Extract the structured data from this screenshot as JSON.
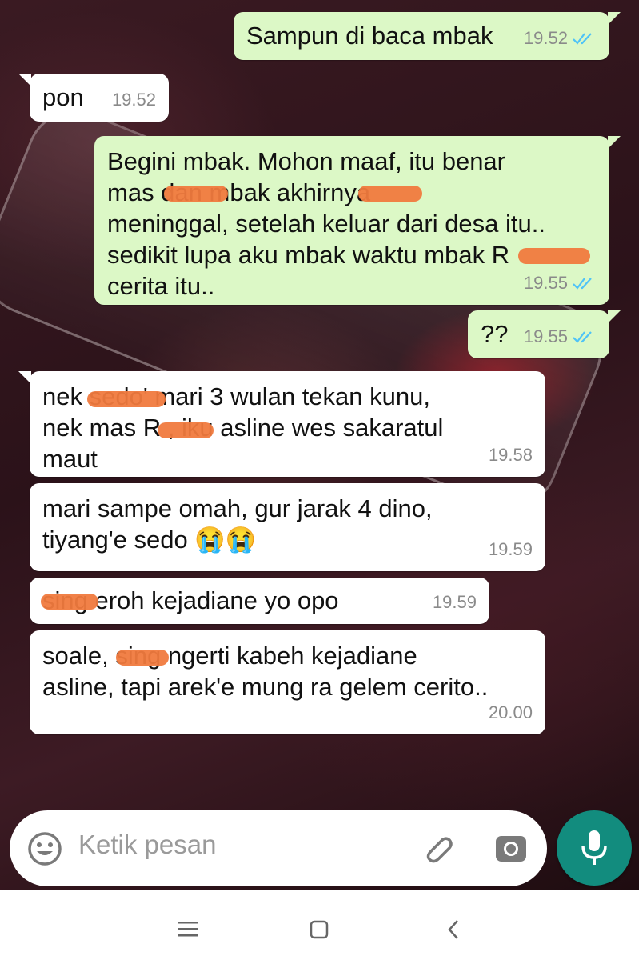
{
  "chat": {
    "messages": [
      {
        "direction": "outgoing",
        "text": "Sampun di baca mbak",
        "time": "19.52",
        "status": "read"
      },
      {
        "direction": "incoming",
        "text": "pon",
        "time": "19.52"
      },
      {
        "direction": "outgoing",
        "text": "Begini mbak. Mohon maaf, itu benar\nmas          dan mbak          akhirnya\nmeninggal, setelah keluar dari desa itu..\nsedikit lupa aku mbak waktu mbak R\ncerita itu..",
        "time": "19.55",
        "status": "read"
      },
      {
        "direction": "outgoing",
        "text": "??",
        "time": "19.55",
        "status": "read"
      },
      {
        "direction": "incoming",
        "text": "nek           sedo' mari 3 wulan tekan kunu,\nnek mas R        , iku asline wes sakaratul\nmaut",
        "time": "19.58"
      },
      {
        "direction": "incoming",
        "text": "mari sampe omah, gur jarak 4 dino,\ntiyang'e sedo 😭😭",
        "time": "19.59"
      },
      {
        "direction": "incoming",
        "text": "         sing eroh kejadiane yo opo",
        "time": "19.59"
      },
      {
        "direction": "incoming",
        "text": "soale,          sing ngerti kabeh kejadiane\nasline, tapi arek'e mung ra gelem cerito..",
        "time": "20.00"
      }
    ]
  },
  "composer": {
    "placeholder": "Ketik pesan",
    "icons": [
      "emoji-icon",
      "attach-icon",
      "camera-icon"
    ],
    "mic_icon": "mic-icon"
  },
  "nav": {
    "icons": [
      "menu-icon",
      "home-icon",
      "back-icon"
    ]
  },
  "colors": {
    "outgoing_bubble": "#dcf8c6",
    "incoming_bubble": "#ffffff",
    "read_ticks": "#4fc3f7",
    "mic_button": "#128c7e"
  }
}
